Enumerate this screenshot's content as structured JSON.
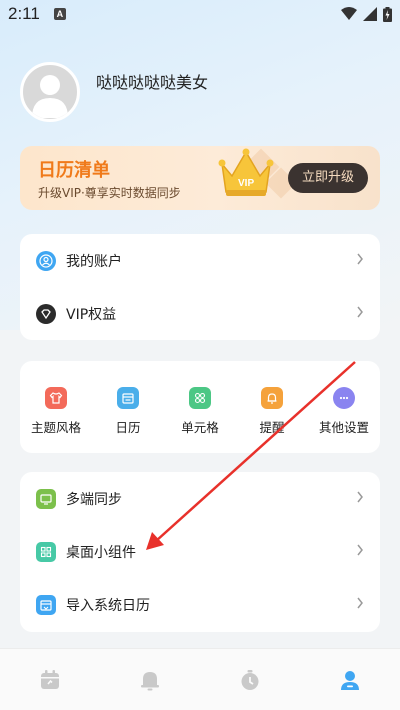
{
  "status": {
    "time": "2:11",
    "notif_letter": "A"
  },
  "profile": {
    "username": "哒哒哒哒哒美女"
  },
  "vip_banner": {
    "title": "日历清单",
    "subtitle": "升级VIP·尊享实时数据同步",
    "crown_text": "VIP",
    "button": "立即升级"
  },
  "account_card": {
    "items": [
      {
        "label": "我的账户",
        "icon": "user-icon",
        "color": "#3fa6f2"
      },
      {
        "label": "VIP权益",
        "icon": "diamond-icon",
        "color": "#2b2b2b"
      }
    ]
  },
  "settings_grid": {
    "items": [
      {
        "label": "主题风格",
        "icon": "shirt-icon",
        "color": "#f36a5a"
      },
      {
        "label": "日历",
        "icon": "calendar-icon",
        "color": "#4aaeea"
      },
      {
        "label": "单元格",
        "icon": "grid-icon",
        "color": "#4cc785"
      },
      {
        "label": "提醒",
        "icon": "bell-icon",
        "color": "#f5a23b"
      },
      {
        "label": "其他设置",
        "icon": "more-icon",
        "color": "#8a84f0"
      }
    ]
  },
  "sync_card": {
    "items": [
      {
        "label": "多端同步",
        "icon": "monitor-icon",
        "color": "#7cc04b"
      },
      {
        "label": "桌面小组件",
        "icon": "widget-icon",
        "color": "#47c9a6"
      },
      {
        "label": "导入系统日历",
        "icon": "import-calendar-icon",
        "color": "#3fa6f2"
      }
    ]
  },
  "tabbar": {
    "tabs": [
      {
        "icon": "calendar-tab-icon",
        "active": false
      },
      {
        "icon": "bell-tab-icon",
        "active": false
      },
      {
        "icon": "timer-tab-icon",
        "active": false
      },
      {
        "icon": "profile-tab-icon",
        "active": true
      }
    ]
  },
  "colors": {
    "accent": "#3fa6f2",
    "vip_orange": "#f07a1a",
    "annotation_arrow": "#e8312b"
  }
}
